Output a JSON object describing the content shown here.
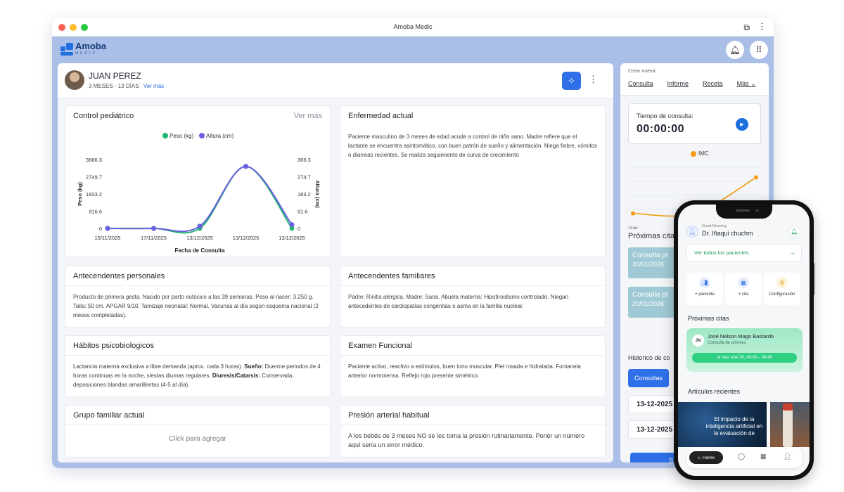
{
  "window": {
    "title": "Amoba Medic"
  },
  "brand": {
    "name": "Amoba",
    "sub": "MEDIC"
  },
  "patient": {
    "name": "JUAN PEREZ",
    "age": "3 MESES - 13 DÍAS",
    "see_more": "Ver más"
  },
  "cards": {
    "control": {
      "title": "Control pediátrico",
      "more": "Ver más"
    },
    "enfermedad": {
      "title": "Enfermedad actual",
      "text": "Paciente masculino de 3 meses de edad acude a control de niño sano. Madre refiere que el lactante se encuentra asintomático, con buen patrón de sueño y alimentación. Niega fiebre, vómitos o diarreas recientes. Se realiza seguimiento de curva de crecimiento"
    },
    "personales": {
      "title": "Antecendentes personales",
      "text": "Producto de primera gesta. Nacido por parto eutócico a las 39 semanas. Peso al nacer: 3.250 g. Talla: 50 cm. APGAR 9/10. Tamizaje neonatal: Normal. Vacunas al día según esquema nacional (2 meses completadas)."
    },
    "familiares": {
      "title": "Antecendentes familiares",
      "text": "Padre: Rinitis alérgica. Madre: Sana. Abuela materna: Hipotiroidismo controlado. Niegan antecedentes de cardiopatías congénitas o asma en la familia nuclear."
    },
    "habitos": {
      "title": "Hábitos psicobiologicos",
      "t1": "Lactancia materna exclusiva a libre demanda (aprox. cada 3 horas). ",
      "b1": "Sueño:",
      "t2": " Duerme periodos de 4 horas continuas en la noche, siestas diurnas regulares. ",
      "b2": "Diuresis/Catarsis:",
      "t3": " Conservada, deposiciones blandas amarillentas (4-5 al día)."
    },
    "examen": {
      "title": "Examen Funcional",
      "text": "Paciente activo, reactivo a estímulos, buen tono muscular. Piel rosada e hidratada. Fontanela anterior normotensa. Reflejo rojo presente simétrico."
    },
    "grupo": {
      "title": "Grupo familiar actual",
      "empty": "Click para agregar"
    },
    "presion": {
      "title": "Presión arterial habitual",
      "text": "A los bebés de 3 meses NO se les toma la presión rutinariamente. Poner un número aquí sería un error médico."
    }
  },
  "chart_data": [
    {
      "type": "line",
      "title": "",
      "xlabel": "Fecha de Consulta",
      "ylabel": "Peso (kg)",
      "y2label": "Altura (cm)",
      "categories": [
        "15/11/2025",
        "17/11/2025",
        "13/12/2025",
        "13/12/2025",
        "13/12/2025"
      ],
      "yticks": [
        "0",
        "916.6",
        "1833.2",
        "2749.7",
        "3666.3"
      ],
      "y2ticks": [
        "0",
        "91.6",
        "183.2",
        "274.7",
        "366.3"
      ],
      "ylim": [
        0,
        3666.3
      ],
      "y2lim": [
        0,
        366.3
      ],
      "legend": "top",
      "series": [
        {
          "name": "Peso (kg)",
          "color": "#22b573",
          "axis": "left",
          "values": [
            4.5,
            5.2,
            6.8,
            3300,
            7.2
          ]
        },
        {
          "name": "Altura (cm)",
          "color": "#6a5fe0",
          "axis": "right",
          "values": [
            0,
            0,
            12,
            330,
            20
          ]
        }
      ]
    },
    {
      "type": "line",
      "legend": "top",
      "categories": [
        "13-dic",
        "",
        ""
      ],
      "series": [
        {
          "name": "IMC",
          "color": "#f39c12",
          "values": [
            0.18,
            0.18,
            0.82
          ]
        }
      ]
    }
  ],
  "right": {
    "crear_label": "Crear nueva:",
    "links": [
      "Consulta",
      "Informe",
      "Receta",
      "Más"
    ],
    "timer_label": "Tiempo de consulta:",
    "timer_value": "00:00:00",
    "imc": "IMC",
    "citas_title": "Próximas cita",
    "citas": [
      {
        "a": "Consulta pr",
        "b": "20/01/2026"
      },
      {
        "a": "Consulta pr",
        "b": "20/01/2026"
      }
    ],
    "hist_title": "Historico de co",
    "consultas_btn": "Consultas",
    "dates": [
      "13-12-2025",
      "13-12-2025"
    ],
    "big_btn": "S",
    "date_cut": "13-11-2025"
  },
  "phone": {
    "greeting": "Good Morning",
    "doctor": "Dr. Iñaqui chuchm",
    "see_all": "Ver todos los pacientes",
    "actions": [
      {
        "label": "+ paciente",
        "icon": "user-plus-icon",
        "color": "#e6eefc",
        "fg": "#2f6fe8"
      },
      {
        "label": "+ cita",
        "icon": "calendar-icon",
        "color": "#e6eefc",
        "fg": "#2f6fe8"
      },
      {
        "label": "Configuración",
        "icon": "gear-icon",
        "color": "#fdf2dc",
        "fg": "#e0a21a"
      }
    ],
    "proximas": "Próximas citas",
    "appt": {
      "initials": "JN",
      "name": "José Nelson Mago Bastardo",
      "type": "Consulta de primera",
      "time": "mar, ene 20, 09:30 – 09:45"
    },
    "articulos": "Artículos recientes",
    "article1": "El impacto de la inteligencia artificial en la evaluación de",
    "nav_home": "Home"
  }
}
